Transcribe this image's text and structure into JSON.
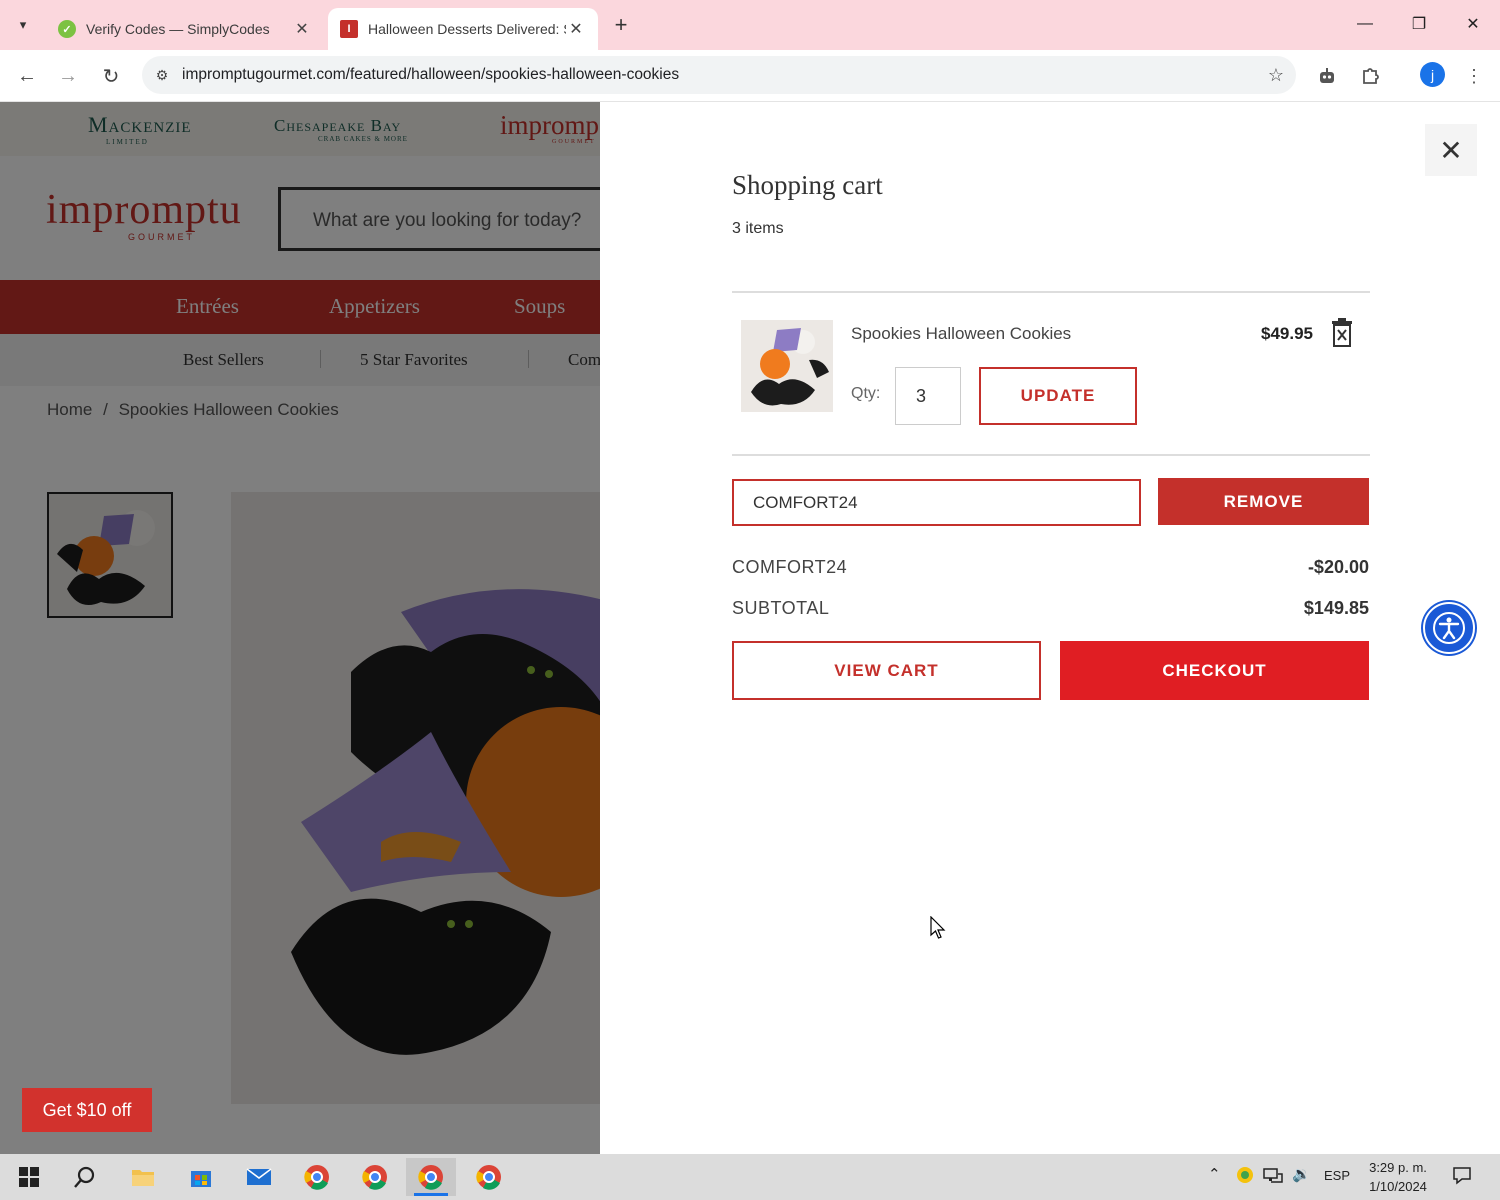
{
  "browser": {
    "tabs": [
      {
        "title": "Verify Codes — SimplyCodes",
        "active": false
      },
      {
        "title": "Halloween Desserts Delivered: S",
        "active": true
      }
    ],
    "url": "impromptugourmet.com/featured/halloween/spookies-halloween-cookies",
    "profile_initial": "j"
  },
  "page": {
    "brands": [
      "Mackenzie",
      "Chesapeake Bay",
      "impromp"
    ],
    "brand_sub": [
      "LIMITED",
      "CRAB CAKES & MORE",
      "GOURMET"
    ],
    "logo": "impromptu",
    "logo_sub": "GOURMET",
    "search_placeholder": "What are you looking for today?",
    "categories": [
      "Entrées",
      "Appetizers",
      "Soups"
    ],
    "subnav": [
      "Best Sellers",
      "5 Star Favorites",
      "Com"
    ],
    "breadcrumb": [
      "Home",
      "Spookies Halloween Cookies"
    ],
    "breadcrumb_sep": "/",
    "promo_button": "Get $10 off"
  },
  "cart": {
    "title": "Shopping cart",
    "count": "3 items",
    "items": [
      {
        "name": "Spookies Halloween Cookies",
        "price": "$49.95",
        "qty_label": "Qty:",
        "qty": "3"
      }
    ],
    "update_label": "UPDATE",
    "coupon_code": "COMFORT24",
    "remove_label": "REMOVE",
    "discount_label": "COMFORT24",
    "discount_value": "-$20.00",
    "subtotal_label": "SUBTOTAL",
    "subtotal_value": "$149.85",
    "view_cart_label": "VIEW CART",
    "checkout_label": "CHECKOUT"
  },
  "taskbar": {
    "lang": "ESP",
    "time": "3:29 p. m.",
    "date": "1/10/2024"
  },
  "colors": {
    "brand_red": "#c4302b",
    "checkout_red": "#e01e23",
    "a11y_blue": "#1a59d6"
  }
}
